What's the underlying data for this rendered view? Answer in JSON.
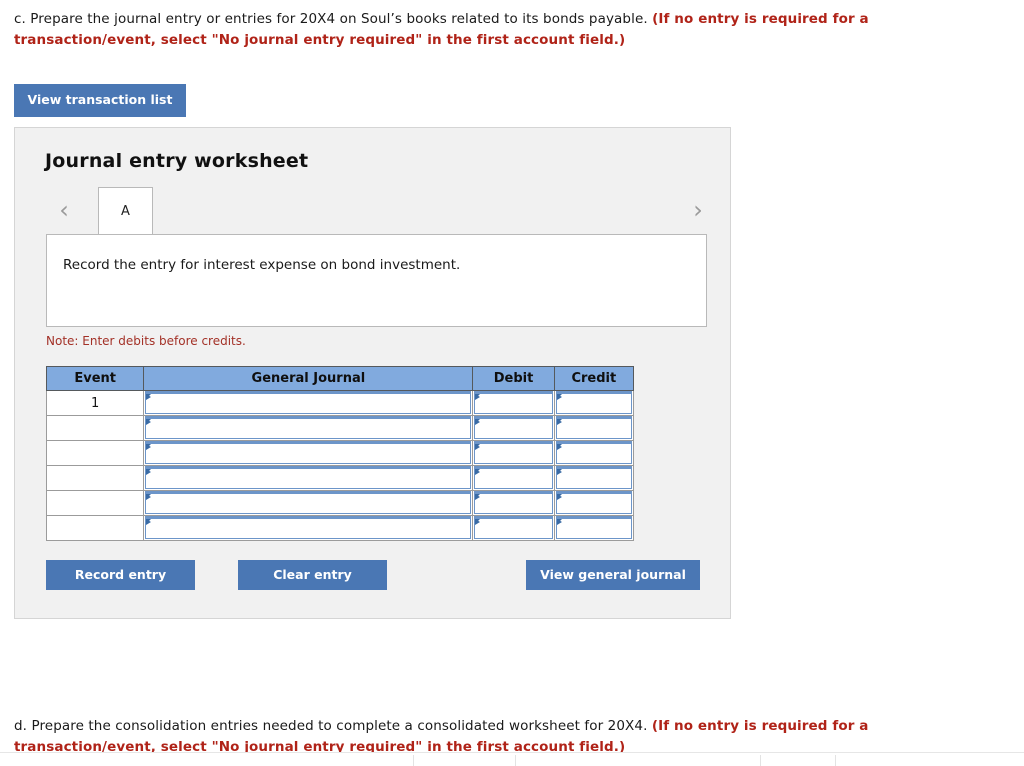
{
  "prompts": {
    "c": {
      "plain": "c. Prepare the journal entry or entries for 20X4 on Soul’s books related to its bonds payable. ",
      "bold_red": "(If no entry is required for a transaction/event, select \"No journal entry required\" in the first account field.)"
    },
    "d": {
      "plain": "d. Prepare the consolidation entries needed to complete a consolidated worksheet for 20X4. ",
      "bold_red": "(If no entry is required for a transaction/event, select \"No journal entry required\" in the first account field.)"
    }
  },
  "toolbar": {
    "view_transaction_list_label": "View transaction list"
  },
  "worksheet": {
    "title": "Journal entry worksheet",
    "prev_chevron": "‹",
    "next_chevron": "›",
    "tabs": [
      {
        "label": "A",
        "active": true
      }
    ],
    "instruction": "Record the entry for interest expense on bond investment.",
    "note": "Note: Enter debits before credits."
  },
  "journal_table": {
    "columns": [
      "Event",
      "General Journal",
      "Debit",
      "Credit"
    ],
    "rows": [
      {
        "event": "1",
        "general_journal": "",
        "debit": "",
        "credit": ""
      },
      {
        "event": "",
        "general_journal": "",
        "debit": "",
        "credit": ""
      },
      {
        "event": "",
        "general_journal": "",
        "debit": "",
        "credit": ""
      },
      {
        "event": "",
        "general_journal": "",
        "debit": "",
        "credit": ""
      },
      {
        "event": "",
        "general_journal": "",
        "debit": "",
        "credit": ""
      },
      {
        "event": "",
        "general_journal": "",
        "debit": "",
        "credit": ""
      }
    ]
  },
  "actions": {
    "record_entry_label": "Record entry",
    "clear_entry_label": "Clear entry",
    "view_general_journal_label": "View general journal"
  },
  "colors": {
    "button_blue": "#4a77b4",
    "table_header_blue": "#81aade",
    "input_border_blue": "#6c95c9",
    "marker_blue": "#3a6ba5",
    "alert_red": "#b02318",
    "note_red": "#a33127",
    "panel_bg": "#f1f1f1"
  }
}
